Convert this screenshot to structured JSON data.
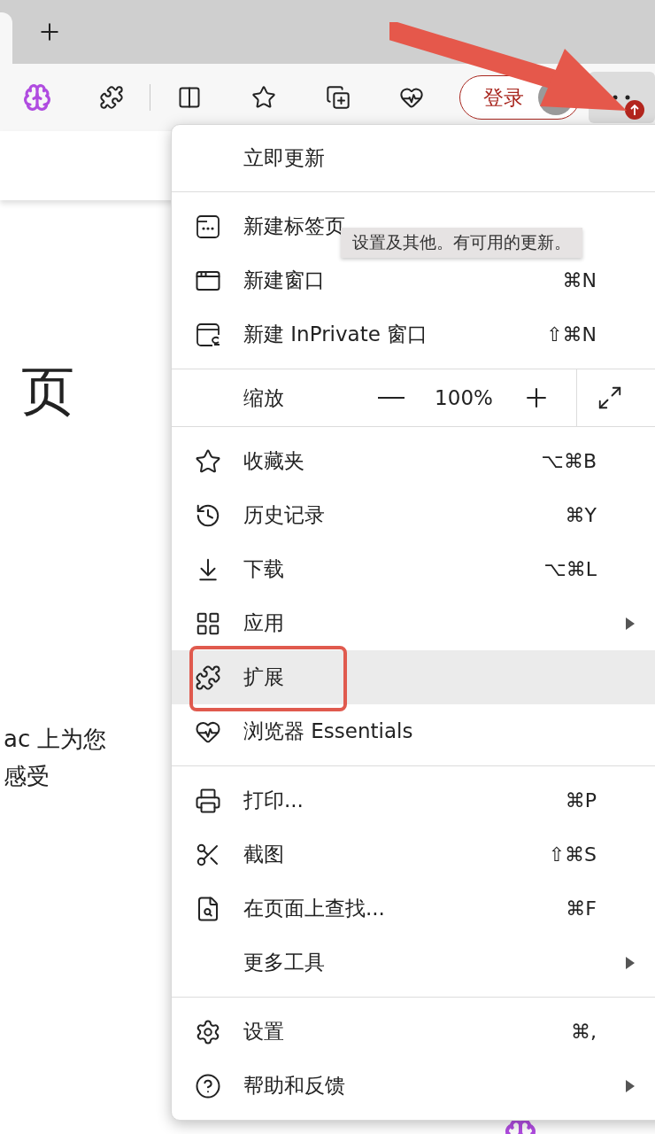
{
  "toolbar": {
    "login_button": "登录"
  },
  "page": {
    "heading": "页",
    "body_lines": [
      "ac 上为您",
      "感受"
    ]
  },
  "menu": {
    "update_item": "立即更新",
    "groups": [
      {
        "items": [
          {
            "label": "新建标签页",
            "submenu": false,
            "highlighted": false
          },
          {
            "label": "新建窗口",
            "shortcut": "⌘N",
            "submenu": false,
            "highlighted": false
          },
          {
            "label": "新建 InPrivate 窗口",
            "shortcut": "⇧⌘N",
            "submenu": false,
            "highlighted": false
          }
        ]
      },
      {
        "zoom": {
          "label": "缩放",
          "value": "100%"
        }
      },
      {
        "items": [
          {
            "label": "收藏夹",
            "shortcut": "⌥⌘B",
            "submenu": false,
            "highlighted": false
          },
          {
            "label": "历史记录",
            "shortcut": "⌘Y",
            "submenu": false,
            "highlighted": false
          },
          {
            "label": "下载",
            "shortcut": "⌥⌘L",
            "submenu": false,
            "highlighted": false
          },
          {
            "label": "应用",
            "submenu": true,
            "highlighted": false
          },
          {
            "label": "扩展",
            "submenu": false,
            "highlighted": true
          },
          {
            "label": "浏览器 Essentials",
            "submenu": false,
            "highlighted": false
          }
        ]
      },
      {
        "items": [
          {
            "label": "打印...",
            "shortcut": "⌘P",
            "submenu": false,
            "highlighted": false
          },
          {
            "label": "截图",
            "shortcut": "⇧⌘S",
            "submenu": false,
            "highlighted": false
          },
          {
            "label": "在页面上查找...",
            "shortcut": "⌘F",
            "submenu": false,
            "highlighted": false
          },
          {
            "label": "更多工具",
            "submenu": true,
            "highlighted": false
          }
        ]
      },
      {
        "items": [
          {
            "label": "设置",
            "shortcut": "⌘,",
            "submenu": false,
            "highlighted": false
          },
          {
            "label": "帮助和反馈",
            "submenu": true,
            "highlighted": false
          }
        ]
      }
    ]
  },
  "tooltip": "设置及其他。有可用的更新。"
}
